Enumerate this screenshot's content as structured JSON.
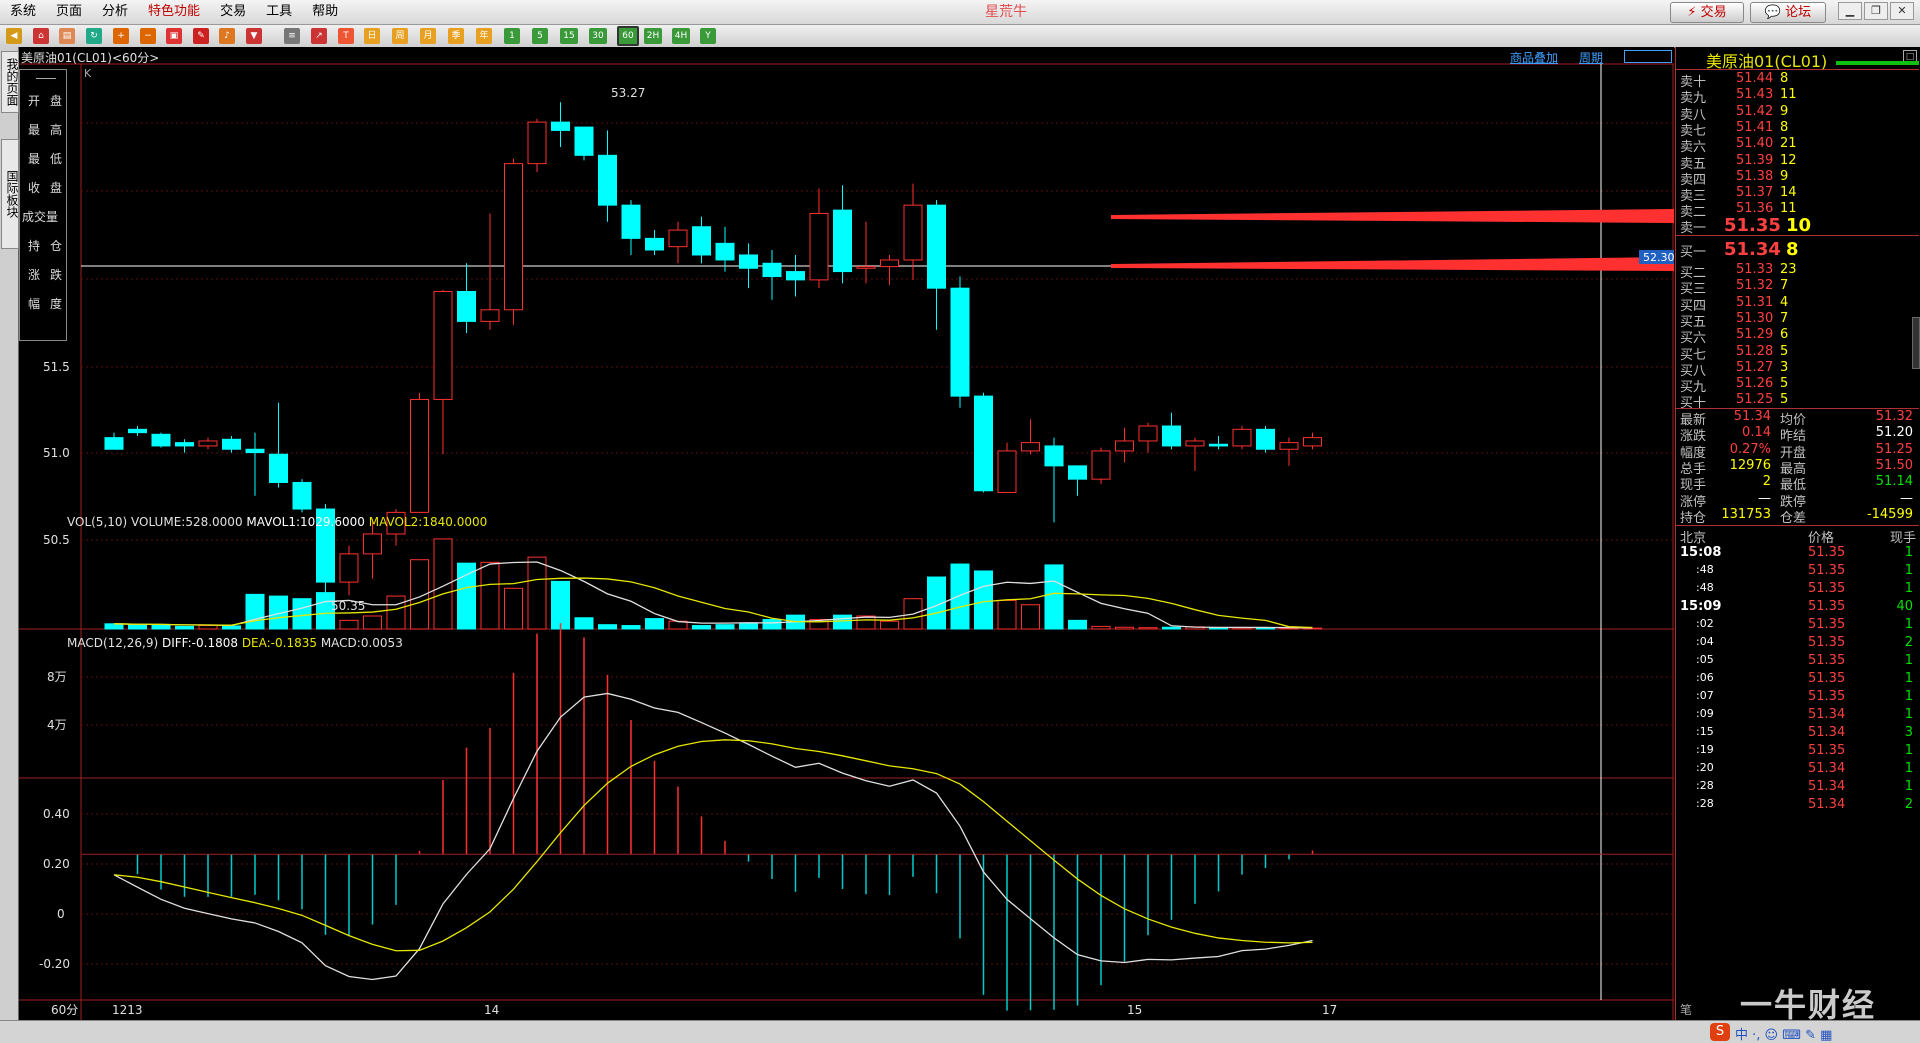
{
  "menu": [
    "系统",
    "页面",
    "分析",
    "特色功能",
    "交易",
    "工具",
    "帮助"
  ],
  "app_title": "星荒牛",
  "top_buttons": {
    "trade": "交易",
    "forum": "论坛"
  },
  "toolbar": {
    "periods": [
      "1",
      "5",
      "15",
      "30",
      "60",
      "2H",
      "4H",
      "Y"
    ],
    "active_period": "60",
    "day_labels": [
      "日",
      "周",
      "月",
      "季",
      "年"
    ]
  },
  "left_tabs": [
    "我的页面",
    "国际板块"
  ],
  "chart_header": {
    "symbol_info": "美原油01(CL01)<60分>",
    "links": [
      "商品叠加",
      "周期"
    ],
    "k_label": "K"
  },
  "ohlc_box": {
    "labels": [
      "开",
      "盘",
      "最",
      "高",
      "最",
      "低",
      "收",
      "盘",
      "成交量",
      "持",
      "仓",
      "涨",
      "跌",
      "幅",
      "度"
    ]
  },
  "price_axis": {
    "ticks": [
      "51.5",
      "51.0",
      "50.5"
    ],
    "high_label": "53.27",
    "low_label": "50.35",
    "current_tag": "52.30"
  },
  "vol_header": {
    "main": "VOL(5,10) VOLUME:528.0000",
    "mavol1": "MAVOL1:1029.6000",
    "mavol2": "MAVOL2:1840.0000"
  },
  "vol_axis": {
    "ticks": [
      "8万",
      "4万"
    ]
  },
  "macd_header": {
    "main": "MACD(12,26,9)",
    "diff": "DIFF:-0.1808",
    "dea": "DEA:-0.1835",
    "macd": "MACD:0.0053"
  },
  "macd_axis": {
    "ticks": [
      "0.40",
      "0.20",
      "0",
      "-0.20"
    ]
  },
  "x_axis": {
    "period": "60分",
    "labels": [
      "1213",
      "14",
      "15",
      "17"
    ]
  },
  "quote": {
    "title": "美原油01(CL01)",
    "asks": [
      {
        "label": "卖十",
        "price": "51.44",
        "vol": "8"
      },
      {
        "label": "卖九",
        "price": "51.43",
        "vol": "11"
      },
      {
        "label": "卖八",
        "price": "51.42",
        "vol": "9"
      },
      {
        "label": "卖七",
        "price": "51.41",
        "vol": "8"
      },
      {
        "label": "卖六",
        "price": "51.40",
        "vol": "21"
      },
      {
        "label": "卖五",
        "price": "51.39",
        "vol": "12"
      },
      {
        "label": "卖四",
        "price": "51.38",
        "vol": "9"
      },
      {
        "label": "卖三",
        "price": "51.37",
        "vol": "14"
      },
      {
        "label": "卖二",
        "price": "51.36",
        "vol": "11"
      },
      {
        "label": "卖一",
        "price": "51.35",
        "vol": "10"
      }
    ],
    "bids": [
      {
        "label": "买一",
        "price": "51.34",
        "vol": "8"
      },
      {
        "label": "买二",
        "price": "51.33",
        "vol": "23"
      },
      {
        "label": "买三",
        "price": "51.32",
        "vol": "7"
      },
      {
        "label": "买四",
        "price": "51.31",
        "vol": "4"
      },
      {
        "label": "买五",
        "price": "51.30",
        "vol": "7"
      },
      {
        "label": "买六",
        "price": "51.29",
        "vol": "6"
      },
      {
        "label": "买七",
        "price": "51.28",
        "vol": "5"
      },
      {
        "label": "买八",
        "price": "51.27",
        "vol": "3"
      },
      {
        "label": "买九",
        "price": "51.26",
        "vol": "5"
      },
      {
        "label": "买十",
        "price": "51.25",
        "vol": "5"
      }
    ],
    "stats": [
      {
        "l1": "最新",
        "v1": "51.34",
        "l2": "均价",
        "v2": "51.32"
      },
      {
        "l1": "涨跌",
        "v1": "0.14",
        "l2": "昨结",
        "v2": "51.20"
      },
      {
        "l1": "幅度",
        "v1": "0.27%",
        "l2": "开盘",
        "v2": "51.25"
      },
      {
        "l1": "总手",
        "v1": "12976",
        "l2": "最高",
        "v2": "51.50"
      },
      {
        "l1": "现手",
        "v1": "2",
        "l2": "最低",
        "v2": "51.14"
      },
      {
        "l1": "涨停",
        "v1": "—",
        "l2": "跌停",
        "v2": "—"
      },
      {
        "l1": "持仓",
        "v1": "131753",
        "l2": "仓差",
        "v2": "-14599"
      }
    ],
    "ticks_header": {
      "time": "北京",
      "price": "价格",
      "vol": "现手"
    },
    "ticks": [
      {
        "t": "15:08",
        "p": "51.35",
        "v": "1",
        "bold": true
      },
      {
        "t": ":48",
        "p": "51.35",
        "v": "1"
      },
      {
        "t": ":48",
        "p": "51.35",
        "v": "1"
      },
      {
        "t": "15:09",
        "p": "51.35",
        "v": "40",
        "bold": true
      },
      {
        "t": ":02",
        "p": "51.35",
        "v": "1"
      },
      {
        "t": ":04",
        "p": "51.35",
        "v": "2"
      },
      {
        "t": ":05",
        "p": "51.35",
        "v": "1"
      },
      {
        "t": ":06",
        "p": "51.35",
        "v": "1"
      },
      {
        "t": ":07",
        "p": "51.35",
        "v": "1"
      },
      {
        "t": ":09",
        "p": "51.34",
        "v": "1"
      },
      {
        "t": ":15",
        "p": "51.34",
        "v": "3"
      },
      {
        "t": ":19",
        "p": "51.35",
        "v": "1"
      },
      {
        "t": ":20",
        "p": "51.34",
        "v": "1"
      },
      {
        "t": ":28",
        "p": "51.34",
        "v": "1"
      },
      {
        "t": ":28",
        "p": "51.34",
        "v": "2"
      }
    ],
    "footer_label": "笔"
  },
  "watermark": "一牛财经",
  "chart_data": {
    "type": "candlestick",
    "y_range": [
      50.3,
      53.6
    ],
    "candles": [
      [
        51.35,
        51.28,
        51.38,
        51.28
      ],
      [
        51.4,
        51.38,
        51.42,
        51.36
      ],
      [
        51.37,
        51.3,
        51.38,
        51.29
      ],
      [
        51.32,
        51.3,
        51.34,
        51.26
      ],
      [
        51.3,
        51.33,
        51.35,
        51.28
      ],
      [
        51.34,
        51.28,
        51.36,
        51.26
      ],
      [
        51.28,
        51.26,
        51.38,
        51.0
      ],
      [
        51.25,
        51.08,
        51.56,
        51.05
      ],
      [
        51.08,
        50.92,
        51.1,
        50.9
      ],
      [
        50.92,
        50.48,
        50.95,
        50.4
      ],
      [
        50.48,
        50.65,
        50.7,
        50.4
      ],
      [
        50.65,
        50.77,
        50.86,
        50.5
      ],
      [
        50.77,
        50.9,
        50.92,
        50.7
      ],
      [
        50.9,
        51.58,
        51.62,
        50.9
      ],
      [
        51.58,
        52.23,
        52.24,
        51.25
      ],
      [
        52.23,
        52.05,
        52.4,
        51.98
      ],
      [
        52.05,
        52.12,
        52.7,
        52.0
      ],
      [
        52.12,
        53.0,
        53.03,
        52.03
      ],
      [
        53.0,
        53.25,
        53.27,
        52.95
      ],
      [
        53.25,
        53.2,
        53.37,
        53.1
      ],
      [
        53.22,
        53.05,
        53.22,
        53.02
      ],
      [
        53.05,
        52.75,
        53.2,
        52.65
      ],
      [
        52.75,
        52.55,
        52.78,
        52.45
      ],
      [
        52.55,
        52.48,
        52.6,
        52.45
      ],
      [
        52.5,
        52.6,
        52.65,
        52.4
      ],
      [
        52.62,
        52.45,
        52.68,
        52.4
      ],
      [
        52.52,
        52.42,
        52.62,
        52.35
      ],
      [
        52.45,
        52.37,
        52.52,
        52.25
      ],
      [
        52.4,
        52.32,
        52.48,
        52.18
      ],
      [
        52.35,
        52.3,
        52.45,
        52.2
      ],
      [
        52.3,
        52.7,
        52.85,
        52.25
      ],
      [
        52.72,
        52.35,
        52.87,
        52.28
      ],
      [
        52.37,
        52.38,
        52.65,
        52.28
      ],
      [
        52.38,
        52.42,
        52.45,
        52.27
      ],
      [
        52.42,
        52.75,
        52.88,
        52.3
      ],
      [
        52.75,
        52.25,
        52.78,
        52.0
      ],
      [
        52.25,
        51.6,
        52.32,
        51.53
      ],
      [
        51.6,
        51.03,
        51.62,
        51.02
      ],
      [
        51.02,
        51.27,
        51.32,
        51.02
      ],
      [
        51.27,
        51.32,
        51.46,
        51.25
      ],
      [
        51.3,
        51.18,
        51.35,
        50.84
      ],
      [
        51.18,
        51.1,
        51.18,
        51.0
      ],
      [
        51.1,
        51.27,
        51.29,
        51.07
      ],
      [
        51.27,
        51.33,
        51.41,
        51.2
      ],
      [
        51.33,
        51.42,
        51.44,
        51.26
      ],
      [
        51.42,
        51.3,
        51.5,
        51.28
      ],
      [
        51.3,
        51.33,
        51.35,
        51.15
      ],
      [
        51.31,
        51.3,
        51.36,
        51.28
      ],
      [
        51.3,
        51.4,
        51.42,
        51.28
      ],
      [
        51.4,
        51.28,
        51.42,
        51.26
      ],
      [
        51.28,
        51.32,
        51.35,
        51.18
      ],
      [
        51.3,
        51.35,
        51.38,
        51.28
      ]
    ],
    "volume": [
      6000,
      5000,
      5000,
      3000,
      4000,
      3500,
      40000,
      38000,
      35000,
      42000,
      10000,
      15000,
      38000,
      80000,
      104000,
      76000,
      77000,
      47000,
      83000,
      55000,
      13000,
      5000,
      4000,
      12000,
      9000,
      4000,
      5000,
      6000,
      11000,
      16000,
      11000,
      16000,
      15000,
      9000,
      35000,
      60000,
      75000,
      67000,
      33000,
      28000,
      74000,
      10000,
      3000,
      2000,
      1500,
      2000,
      2500,
      1500,
      1500,
      1500,
      1200,
      1000
    ],
    "vol_ylim": [
      0,
      112000
    ],
    "macd_ylim": [
      -0.34,
      0.5
    ]
  }
}
